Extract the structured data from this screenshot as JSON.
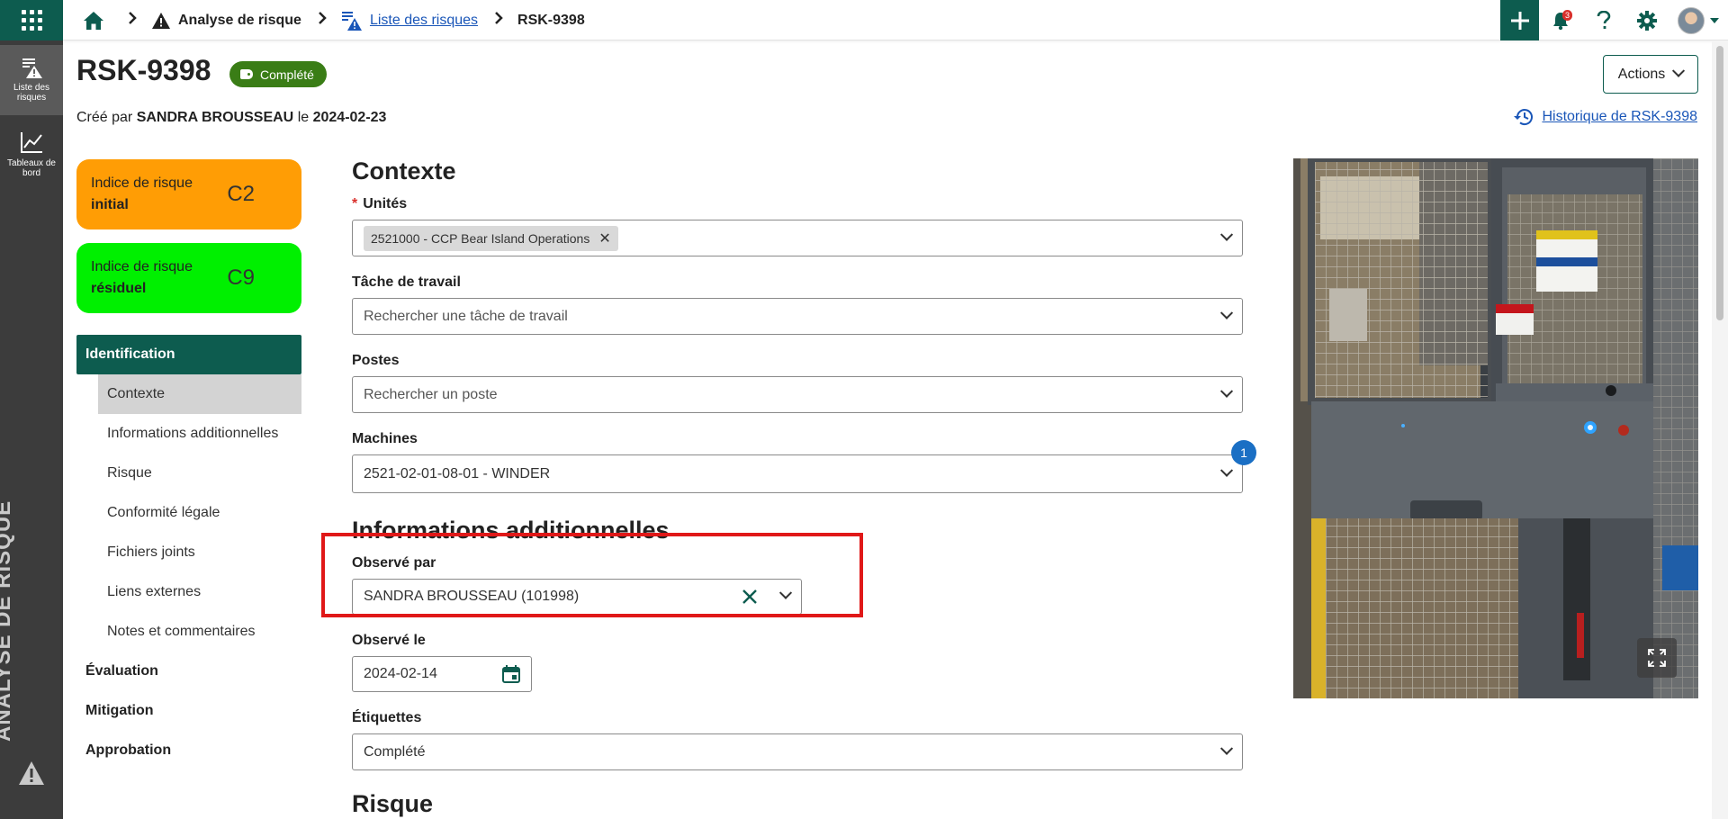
{
  "rail": {
    "items": [
      {
        "label": "Liste des risques",
        "icon": "risk-list-icon"
      },
      {
        "label": "Tableaux de bord",
        "icon": "dashboard-chart-icon"
      }
    ],
    "vertical_title": "ANALYSE DE RISQUE"
  },
  "breadcrumb": {
    "home_icon": "home-icon",
    "module": "Analyse de risque",
    "list": "Liste des risques",
    "current": "RSK-9398"
  },
  "topbar": {
    "notification_count": "3"
  },
  "header": {
    "title": "RSK-9398",
    "status": "Complété",
    "created_prefix": "Créé par",
    "created_by": "SANDRA BROUSSEAU",
    "created_mid": "le",
    "created_date": "2024-02-23",
    "actions_label": "Actions",
    "history_label": "Historique de RSK-9398"
  },
  "risk_cards": [
    {
      "label_top": "Indice de risque",
      "label_bold": "initial",
      "value": "C2",
      "color": "#ff9d05"
    },
    {
      "label_top": "Indice de risque",
      "label_bold": "résiduel",
      "value": "C9",
      "color": "#00f000"
    }
  ],
  "secnav": {
    "group": "Identification",
    "subitems": [
      "Contexte",
      "Informations additionnelles",
      "Risque",
      "Conformité légale",
      "Fichiers joints",
      "Liens externes",
      "Notes et commentaires"
    ],
    "others": [
      "Évaluation",
      "Mitigation",
      "Approbation"
    ]
  },
  "form": {
    "contexte_title": "Contexte",
    "units_label": "Unités",
    "units_chip": "2521000 - CCP Bear Island Operations",
    "task_label": "Tâche de travail",
    "task_placeholder": "Rechercher une tâche de travail",
    "postes_label": "Postes",
    "postes_placeholder": "Rechercher un poste",
    "machines_label": "Machines",
    "machines_value": "2521-02-01-08-01 - WINDER",
    "machines_count": "1",
    "info_title": "Informations additionnelles",
    "observed_by_label": "Observé par",
    "observed_by_value": "SANDRA BROUSSEAU (101998)",
    "observed_on_label": "Observé le",
    "observed_on_value": "2024-02-14",
    "tags_label": "Étiquettes",
    "tags_value": "Complété",
    "risque_title": "Risque"
  },
  "colors": {
    "brand": "#0d5c4f",
    "status_green": "#3a7d16",
    "link": "#1a56b8",
    "highlight": "#e01818"
  }
}
